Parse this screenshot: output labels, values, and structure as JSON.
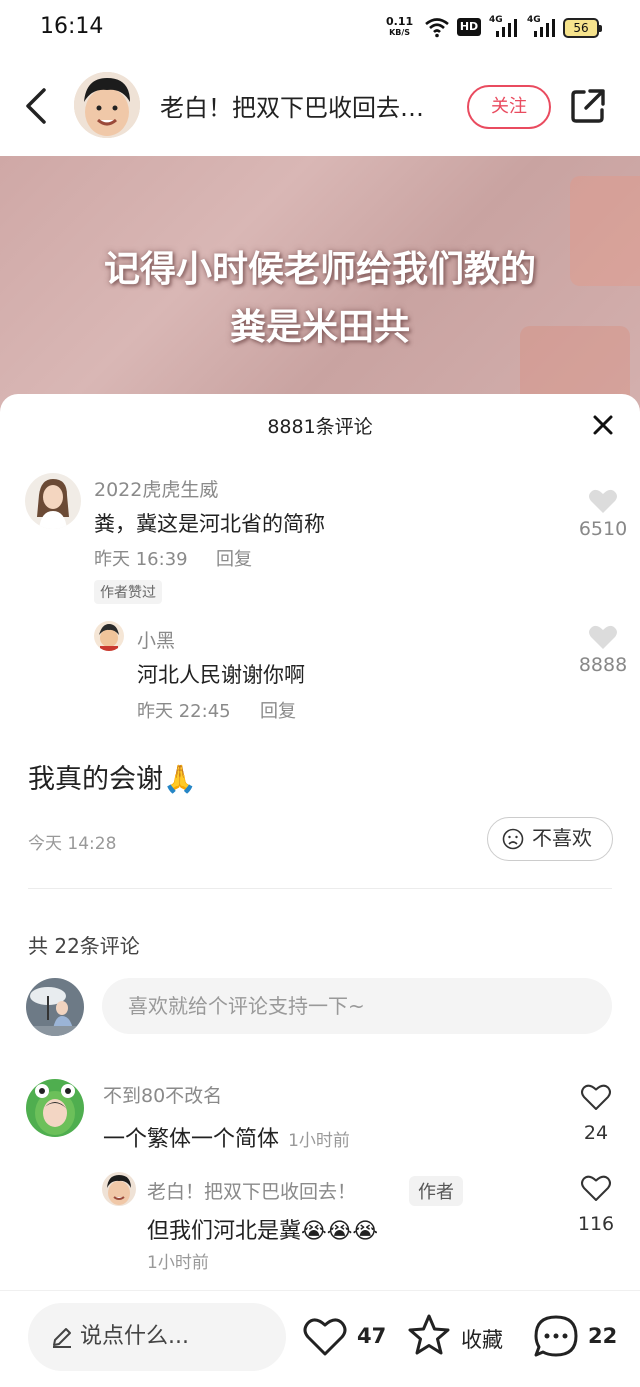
{
  "status_bar": {
    "time": "16:14",
    "net_speed": "0.11",
    "net_speed_unit": "KB/S",
    "hd_label": "HD",
    "signal_1": "4G",
    "signal_2": "4G",
    "battery": "56"
  },
  "header": {
    "author_name": "老白！把双下巴收回去…",
    "follow_label": "关注"
  },
  "video": {
    "line1": "记得小时候老师给我们教的",
    "line2": "粪是米田共"
  },
  "sheet": {
    "title": "8881条评论",
    "comment1": {
      "user": "2022虎虎生威",
      "text": "粪，冀这是河北省的简称",
      "time": "昨天 16:39",
      "reply_label": "回复",
      "tag": "作者赞过",
      "likes": "6510"
    },
    "reply1": {
      "user": "小黑",
      "text": "河北人民谢谢你啊",
      "time": "昨天 22:45",
      "reply_label": "回复",
      "likes": "8888"
    }
  },
  "post": {
    "text": "我真的会谢🙏",
    "time": "今天 14:28",
    "dislike_label": "不喜欢"
  },
  "comments": {
    "count_label": "共 22条评论",
    "input_placeholder": "喜欢就给个评论支持一下~",
    "items": [
      {
        "user": "不到80不改名",
        "text": "一个繁体一个简体",
        "time": "1小时前",
        "likes": "24"
      },
      {
        "user": "老白！把双下巴收回去！",
        "badge": "作者",
        "text": "但我们河北是冀",
        "emoji": "😭😭😭",
        "time": "1小时前",
        "likes": "116"
      }
    ]
  },
  "bottom_bar": {
    "say_placeholder": "说点什么...",
    "likes": "47",
    "collect_label": "收藏",
    "comments": "22"
  },
  "colors": {
    "accent": "#e94b5f",
    "muted_text": "#8a8a8a"
  }
}
